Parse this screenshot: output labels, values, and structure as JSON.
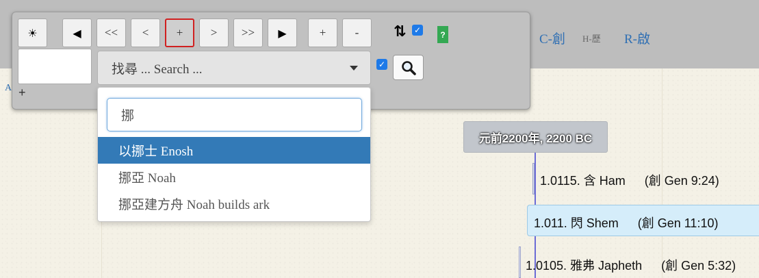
{
  "header_links": {
    "creation": "C-創",
    "history": "H-歷",
    "revelation": "R-啟"
  },
  "close_label": "×",
  "side_label": "A",
  "toolbar": {
    "theme_glyph": "☀",
    "play_back": "◀",
    "fast_back": "<<",
    "step_back": "<",
    "zoom_plus": "+",
    "step_forward": ">",
    "fast_forward": ">>",
    "play_forward": "▶",
    "add": "+",
    "remove": "-",
    "sort_glyph": "⇅",
    "help": "?",
    "add_row": "+"
  },
  "search": {
    "placeholder_display": "找尋 ... Search ...",
    "query": "挪",
    "results": [
      {
        "label": "以挪士 Enosh",
        "selected": true
      },
      {
        "label": "挪亞 Noah",
        "selected": false
      },
      {
        "label": "挪亞建方舟 Noah builds ark",
        "selected": false
      }
    ]
  },
  "timeline": {
    "date_label": "元前2200年, 2200 BC",
    "events": [
      {
        "code": "1.0115. 含 Ham",
        "ref": "(創 Gen 9:24)"
      },
      {
        "code": "1.011. 閃 Shem",
        "ref": "(創 Gen 11:10)"
      },
      {
        "code": "1.0105. 雅弗 Japheth",
        "ref": "(創 Gen 5:32)"
      }
    ]
  },
  "colors": {
    "accent": "#337ab7",
    "active_border": "#d02020",
    "timeline_line": "#6b6bd6"
  }
}
